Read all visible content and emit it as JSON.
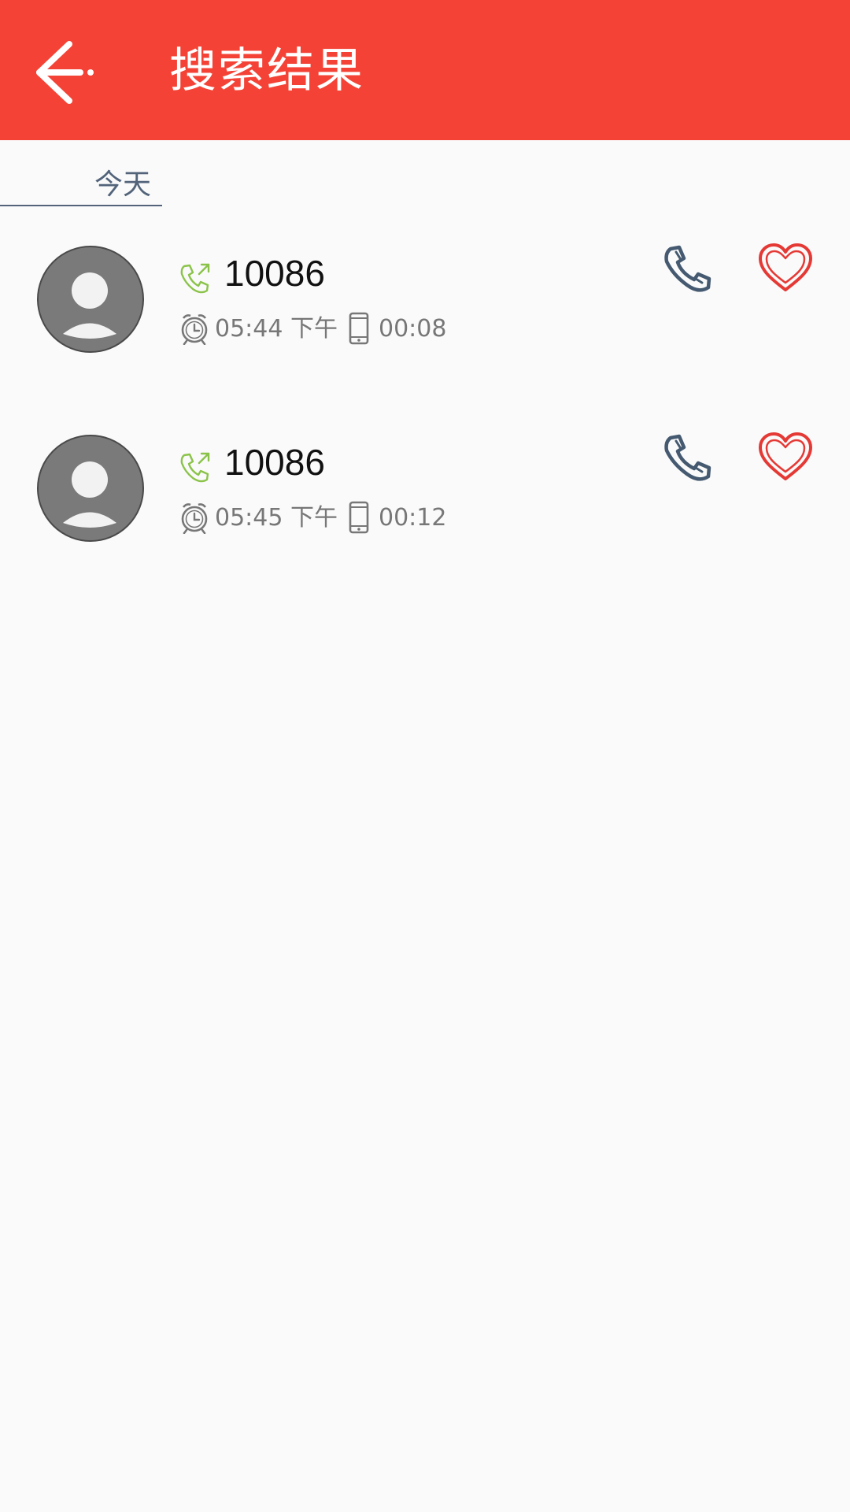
{
  "app_bar": {
    "back_icon": "arrow-back-icon",
    "title": "搜索结果",
    "background": "#f44336"
  },
  "section": {
    "label": "今天"
  },
  "calls": [
    {
      "number": "10086",
      "type_icon": "outgoing-call-icon",
      "time": "05:44 下午",
      "duration": "00:08"
    },
    {
      "number": "10086",
      "type_icon": "outgoing-call-icon",
      "time": "05:45 下午",
      "duration": "00:12"
    }
  ],
  "colors": {
    "accent": "#f44336",
    "outgoing_green": "#8bc34a",
    "call_icon": "#455a70",
    "heart_red": "#e53935",
    "meta_text": "#777777"
  }
}
